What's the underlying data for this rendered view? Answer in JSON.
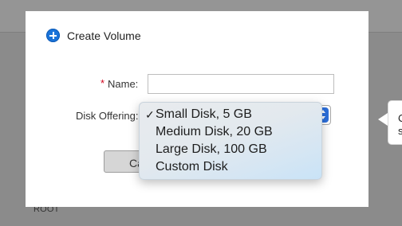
{
  "background": {
    "row_text": "ROOT"
  },
  "dialog": {
    "title": "Create Volume",
    "name_label": "Name:",
    "required_marker": "*",
    "name_value": "",
    "disk_offering_label": "Disk Offering:",
    "disk_offering_selected": "Small Disk, 5 GB",
    "cancel_label": "Ca"
  },
  "dropdown": {
    "options": [
      {
        "label": "Small Disk, 5 GB",
        "selected": true
      },
      {
        "label": "Medium Disk, 20 GB",
        "selected": false
      },
      {
        "label": "Large Disk, 100 GB",
        "selected": false
      },
      {
        "label": "Custom Disk",
        "selected": false
      }
    ],
    "check_glyph": "✓"
  },
  "tooltip": {
    "line1": "C",
    "line2": "s"
  },
  "colors": {
    "accent": "#1a73d9",
    "required": "#d0021b",
    "overlay": "#8b8b8b"
  }
}
